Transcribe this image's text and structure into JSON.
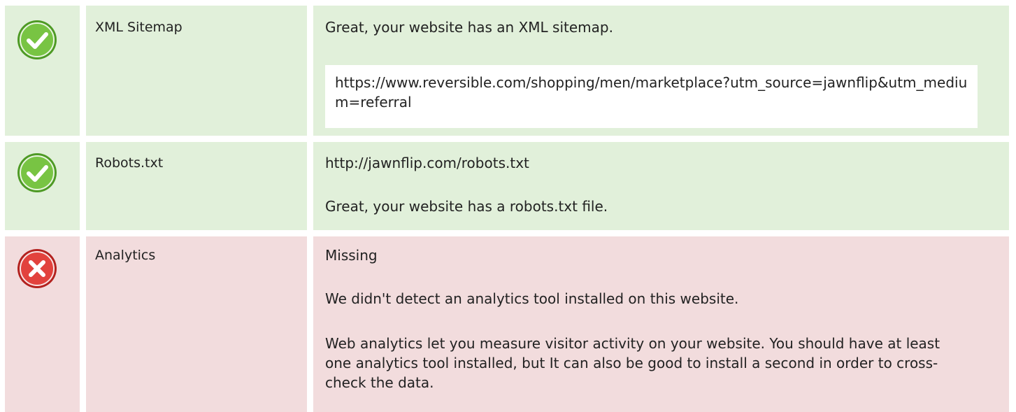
{
  "rows": [
    {
      "status": "pass",
      "icon": "check-circle-icon",
      "label": "XML Sitemap",
      "message": "Great, your website has an XML sitemap.",
      "url": "https://www.reversible.com/shopping/men/marketplace?utm_source=jawnflip&utm_medium=referral"
    },
    {
      "status": "pass",
      "icon": "check-circle-icon",
      "label": "Robots.txt",
      "url": "http://jawnflip.com/robots.txt",
      "message": "Great, your website has a robots.txt file."
    },
    {
      "status": "fail",
      "icon": "x-circle-icon",
      "label": "Analytics",
      "status_text": "Missing",
      "message": "We didn't detect an analytics tool installed on this website.",
      "detail": "Web analytics let you measure visitor activity on your website. You should have at least one analytics tool installed, but It can also be good to install a second in order to cross-check the data."
    }
  ],
  "colors": {
    "pass_bg": "#e1f0da",
    "fail_bg": "#f2dcdd",
    "pass_icon": "#6cbf3a",
    "fail_icon": "#d9322f"
  }
}
